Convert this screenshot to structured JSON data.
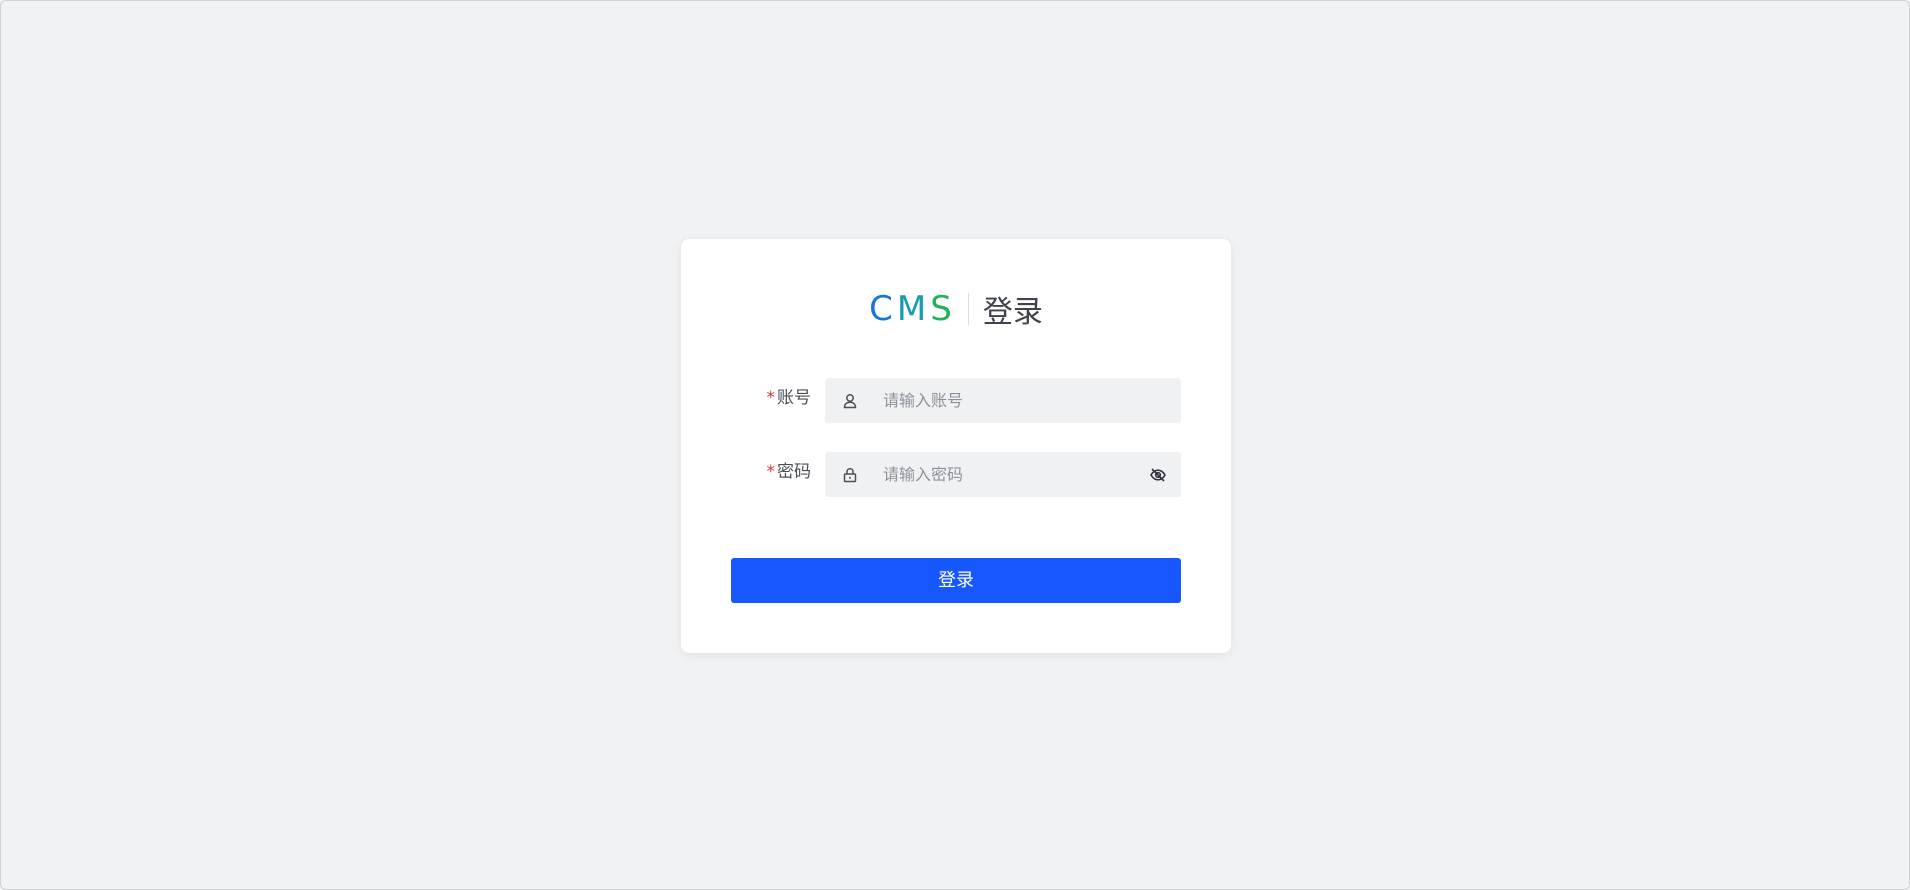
{
  "logo": {
    "letters": [
      "C",
      "M",
      "S"
    ]
  },
  "page_title": "登录",
  "form": {
    "account": {
      "required_mark": "*",
      "label": "账号",
      "placeholder": "请输入账号",
      "prefix_icon": "user-icon"
    },
    "password": {
      "required_mark": "*",
      "label": "密码",
      "placeholder": "请输入密码",
      "prefix_icon": "lock-icon",
      "suffix_icon": "eye-hidden-icon"
    }
  },
  "submit_label": "登录",
  "colors": {
    "background": "#f1f2f4",
    "card": "#ffffff",
    "primary": "#1758fe",
    "required": "#e8323a",
    "logo_c": "#1677d8",
    "logo_m": "#169bb0",
    "logo_s": "#21b35a"
  }
}
